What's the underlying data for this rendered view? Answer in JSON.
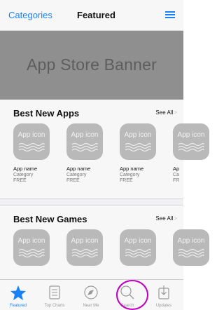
{
  "nav": {
    "left_label": "Categories",
    "title": "Featured",
    "right_icon": "list-icon"
  },
  "banner": {
    "text": "App Store Banner"
  },
  "sections": [
    {
      "title": "Best New Apps",
      "see_all": "See All",
      "apps": [
        {
          "icon_label": "App icon",
          "name": "App name",
          "category": "Category",
          "price": "FREE"
        },
        {
          "icon_label": "App icon",
          "name": "App name",
          "category": "Category",
          "price": "FREE"
        },
        {
          "icon_label": "App icon",
          "name": "App name",
          "category": "Category",
          "price": "FREE"
        },
        {
          "icon_label": "App icon",
          "name": "Ap",
          "category": "Ca",
          "price": "FR"
        }
      ]
    },
    {
      "title": "Best New Games",
      "see_all": "See All",
      "apps": [
        {
          "icon_label": "App icon"
        },
        {
          "icon_label": "App icon"
        },
        {
          "icon_label": "App icon"
        },
        {
          "icon_label": "App icon"
        }
      ]
    }
  ],
  "tabs": [
    {
      "label": "Featured",
      "icon": "star-icon",
      "active": true
    },
    {
      "label": "Top Charts",
      "icon": "list-icon",
      "active": false
    },
    {
      "label": "Near Me",
      "icon": "compass-icon",
      "active": false
    },
    {
      "label": "Search",
      "icon": "search-icon",
      "active": false
    },
    {
      "label": "Updates",
      "icon": "download-icon",
      "active": false
    }
  ],
  "colors": {
    "accent": "#1a82f7",
    "highlight_ring": "#c000c0",
    "banner": "#8f8f8f"
  }
}
